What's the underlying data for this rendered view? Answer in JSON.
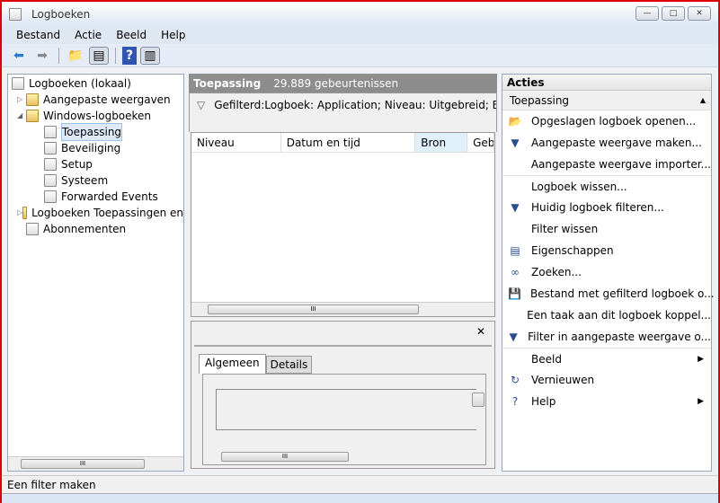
{
  "window": {
    "title": "Logboeken",
    "minimize": "—",
    "maximize": "□",
    "close": "✕"
  },
  "menu": [
    "Bestand",
    "Actie",
    "Beeld",
    "Help"
  ],
  "tree": [
    {
      "label": "Logboeken (lokaal)"
    },
    {
      "label": "Aangepaste weergaven"
    },
    {
      "label": "Windows-logboeken"
    },
    {
      "label": "Toepassing"
    },
    {
      "label": "Beveiliging"
    },
    {
      "label": "Setup"
    },
    {
      "label": "Systeem"
    },
    {
      "label": "Forwarded Events"
    },
    {
      "label": "Logboeken Toepassingen en"
    },
    {
      "label": "Abonnementen"
    }
  ],
  "main": {
    "title": "Toepassing",
    "count": "29.889 gebeurtenissen",
    "filter": "Gefilterd:Logboek: Application; Niveau: Uitgebreid; Bron:",
    "columns": [
      "Niveau",
      "Datum en tijd",
      "Bron",
      "Geb"
    ],
    "tabs": [
      "Algemeen",
      "Details"
    ]
  },
  "actions": {
    "header": "Acties",
    "section": "Toepassing",
    "items": [
      {
        "label": "Opgeslagen logboek openen...",
        "icon": "📂"
      },
      {
        "label": "Aangepaste weergave maken...",
        "icon": "▼"
      },
      {
        "label": "Aangepaste weergave importer...",
        "icon": ""
      },
      {
        "label": "Logboek wissen...",
        "icon": ""
      },
      {
        "label": "Huidig logboek filteren...",
        "icon": "▼"
      },
      {
        "label": "Filter wissen",
        "icon": ""
      },
      {
        "label": "Eigenschappen",
        "icon": "▤"
      },
      {
        "label": "Zoeken...",
        "icon": "∞"
      },
      {
        "label": "Bestand met gefilterd logboek o...",
        "icon": "💾"
      },
      {
        "label": "Een taak aan dit logboek koppel...",
        "icon": ""
      },
      {
        "label": "Filter in aangepaste weergave o...",
        "icon": "▼"
      },
      {
        "label": "Beeld",
        "icon": "",
        "submenu": true
      },
      {
        "label": "Vernieuwen",
        "icon": "↻"
      },
      {
        "label": "Help",
        "icon": "?",
        "submenu": true
      }
    ]
  },
  "status": "Een filter maken"
}
